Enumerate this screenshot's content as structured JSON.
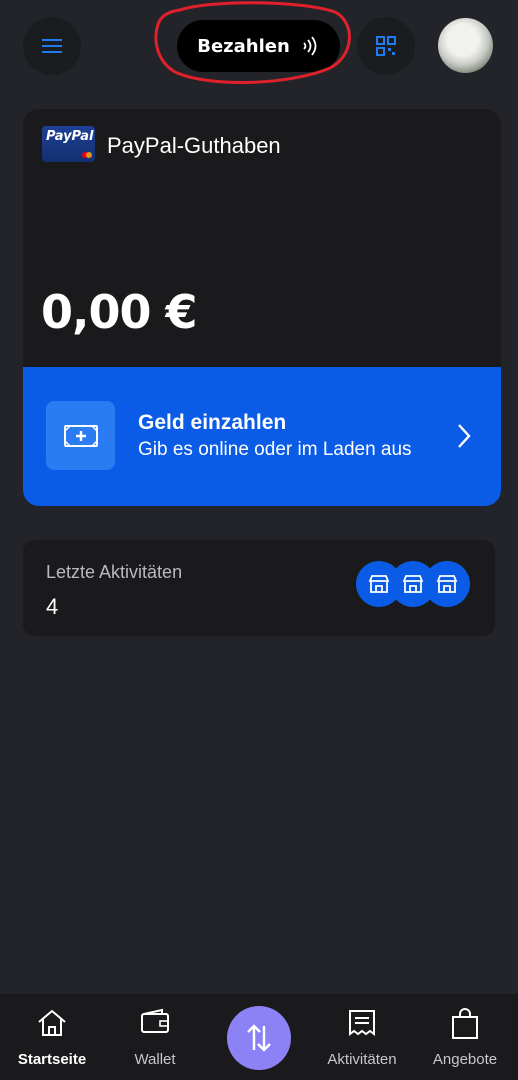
{
  "header": {
    "pay_label": "Bezahlen",
    "menu_icon": "hamburger-menu-icon",
    "qr_icon": "qr-code-icon",
    "contactless_icon": "contactless-icon"
  },
  "balance": {
    "account_name": "PayPal-Guthaben",
    "logo_text": "PayPal",
    "amount": "0,00 €"
  },
  "deposit": {
    "title": "Geld einzahlen",
    "subtitle": "Gib es online oder im Laden aus"
  },
  "activity": {
    "label": "Letzte Aktivitäten",
    "count": "4"
  },
  "nav": {
    "items": [
      {
        "label": "Startseite",
        "icon": "home-icon"
      },
      {
        "label": "Wallet",
        "icon": "wallet-icon"
      },
      {
        "label": "Aktivitäten",
        "icon": "receipt-icon"
      },
      {
        "label": "Angebote",
        "icon": "shopping-bag-icon"
      }
    ],
    "center_icon": "transfer-arrows-icon"
  },
  "colors": {
    "background": "#232429",
    "card": "#1a1a1c",
    "accent_blue": "#0a5ce6",
    "fab_purple": "#8c82f5",
    "annotation_red": "#e0202a"
  }
}
